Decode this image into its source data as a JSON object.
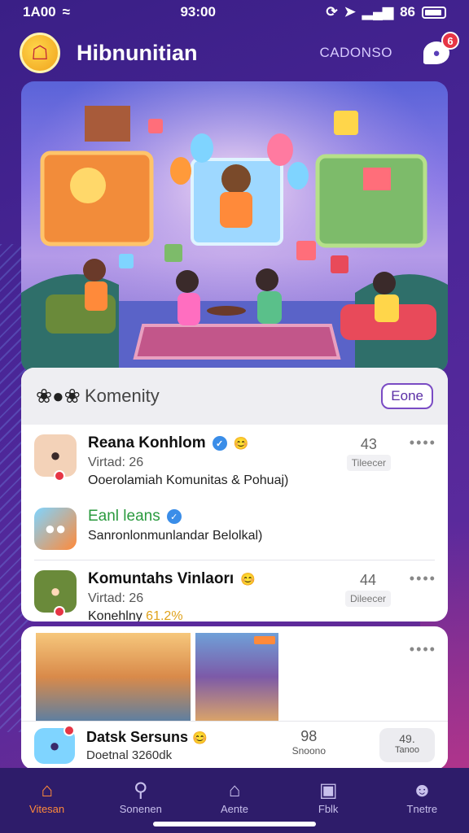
{
  "status_bar": {
    "carrier": "1A00",
    "time": "93:00",
    "signal_text": "86"
  },
  "header": {
    "title": "Hibnunitian",
    "action_label": "CADONSO",
    "notifications": "6"
  },
  "community": {
    "title": "Komenity",
    "done_label": "Eone",
    "rows": [
      {
        "name": "Reana Konhlom",
        "sub": "Virtad: 26",
        "desc": "Ooerolamiah Komunitas & Pohuaj)",
        "stat": "43",
        "stat_label": "Tileecer"
      },
      {
        "name": "Eanl leans",
        "sub": "",
        "desc": "Sanronlonmunlandar Belolkal)",
        "stat": "",
        "stat_label": ""
      },
      {
        "name": "Komuntahs Vinlaorı",
        "sub": "Virtad: 26",
        "desc": "Konehlny",
        "highlight": "61.2%",
        "stat": "44",
        "stat_label": "Dileecer"
      }
    ]
  },
  "gallery": {
    "name": "Datsk Sersuns",
    "sub": "Doetnal 3260dk",
    "stat": "98",
    "stat_label": "Snoono",
    "button_top": "49.",
    "button_label": "Tanoo"
  },
  "nav": [
    {
      "label": "Vitesan",
      "icon": "home-icon",
      "active": true
    },
    {
      "label": "Sonenen",
      "icon": "search-icon",
      "active": false
    },
    {
      "label": "Aente",
      "icon": "house-icon",
      "active": false
    },
    {
      "label": "Fblk",
      "icon": "briefcase-icon",
      "active": false
    },
    {
      "label": "Tnetre",
      "icon": "profile-icon",
      "active": false
    }
  ],
  "colors": {
    "accent": "#ff8a3a",
    "brand": "#4b2698",
    "verified": "#3a8de8"
  }
}
